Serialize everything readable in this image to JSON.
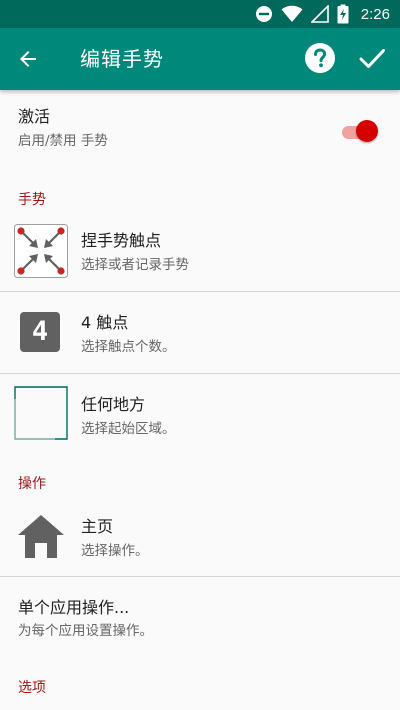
{
  "status_bar": {
    "time": "2:26",
    "icons": [
      "do-not-disturb-icon",
      "wifi-icon",
      "signal-icon",
      "battery-charging-icon"
    ]
  },
  "app_bar": {
    "title": "编辑手势",
    "icons": [
      "back-arrow-icon",
      "help-icon",
      "check-icon"
    ]
  },
  "activate": {
    "title": "激活",
    "subtitle": "启用/禁用 手势",
    "enabled": true
  },
  "sections": {
    "gesture": "手势",
    "action": "操作",
    "options": "选项"
  },
  "gesture_items": [
    {
      "title": "捏手势触点",
      "subtitle": "选择或者记录手势",
      "icon": "pinch-gesture-icon"
    },
    {
      "title": "4 触点",
      "subtitle": "选择触点个数。",
      "icon": "number-4-icon",
      "icon_text": "4"
    },
    {
      "title": "任何地方",
      "subtitle": "选择起始区域。",
      "icon": "area-frame-icon"
    }
  ],
  "action_items": [
    {
      "title": "主页",
      "subtitle": "选择操作。",
      "icon": "home-icon"
    },
    {
      "title": "单个应用操作...",
      "subtitle": "为每个应用设置操作。"
    }
  ],
  "colors": {
    "status_bar": "#00695c",
    "app_bar": "#00897b",
    "accent": "#d50000",
    "section_header": "#a01a1a"
  }
}
